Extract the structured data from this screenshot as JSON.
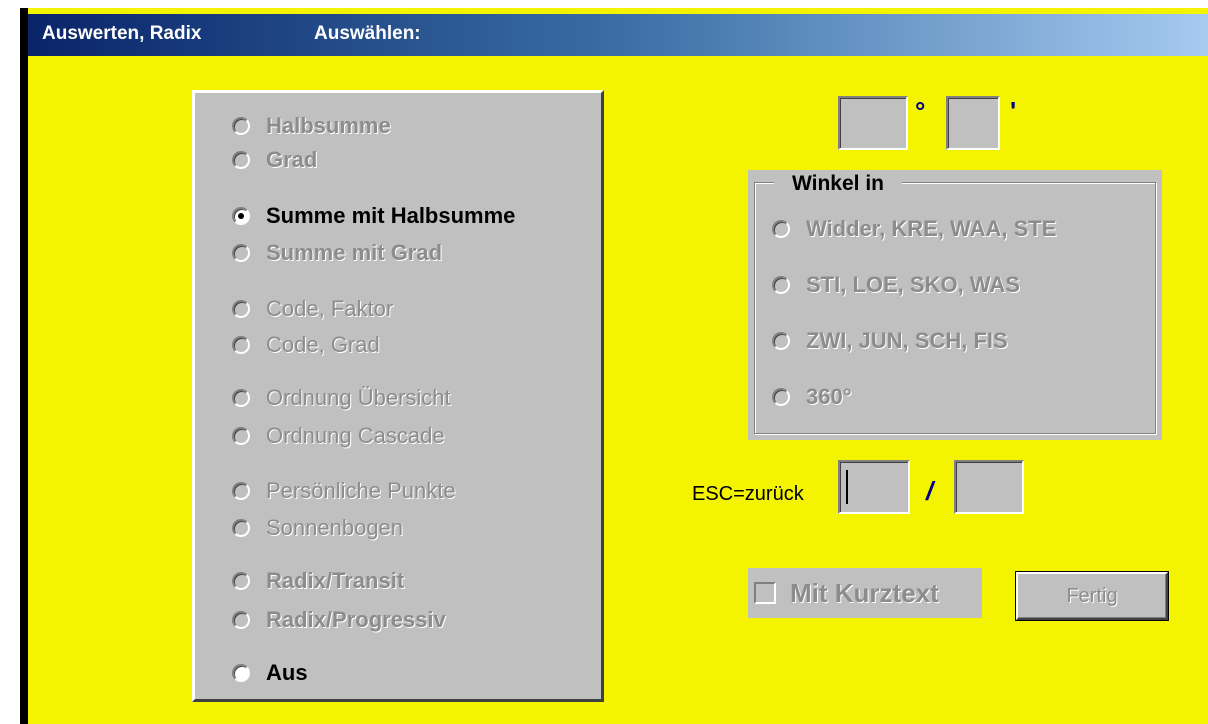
{
  "titlebar": {
    "title_left": "Auswerten, Radix",
    "title_right": "Auswählen:"
  },
  "mode_group": {
    "options": [
      {
        "label": "Halbsumme",
        "checked": false,
        "enabled": false
      },
      {
        "label": "Grad",
        "checked": false,
        "enabled": false
      },
      {
        "label": "Summe mit Halbsumme",
        "checked": true,
        "enabled": true
      },
      {
        "label": "Summe mit Grad",
        "checked": false,
        "enabled": false
      },
      {
        "label": "Code, Faktor",
        "checked": false,
        "enabled": false
      },
      {
        "label": "Code, Grad",
        "checked": false,
        "enabled": false
      },
      {
        "label": "Ordnung Übersicht",
        "checked": false,
        "enabled": false
      },
      {
        "label": "Ordnung Cascade",
        "checked": false,
        "enabled": false
      },
      {
        "label": "Persönliche Punkte",
        "checked": false,
        "enabled": false
      },
      {
        "label": "Sonnenbogen",
        "checked": false,
        "enabled": false
      },
      {
        "label": "Radix/Transit",
        "checked": false,
        "enabled": false
      },
      {
        "label": "Radix/Progressiv",
        "checked": false,
        "enabled": false
      },
      {
        "label": "Aus",
        "checked": false,
        "enabled": true
      }
    ]
  },
  "angle_input": {
    "degree_value": "",
    "degree_symbol": "°",
    "minute_value": "",
    "minute_symbol": "'"
  },
  "winkel_group": {
    "legend": "Winkel in",
    "options": [
      {
        "label": "Widder, KRE, WAA, STE"
      },
      {
        "label": "STI, LOE, SKO, WAS"
      },
      {
        "label": "ZWI, JUN, SCH, FIS"
      },
      {
        "label": "360°"
      }
    ]
  },
  "esc_row": {
    "label": "ESC=zurück",
    "left_value": "",
    "separator": "/",
    "right_value": ""
  },
  "kurztext": {
    "label": "Mit Kurztext",
    "checked": false
  },
  "fertig_button": {
    "label": "Fertig"
  },
  "colors": {
    "background": "#f4f400",
    "dialog_gray": "#c0c0c0",
    "title_start": "#0a246a",
    "title_end": "#a6caf0"
  }
}
